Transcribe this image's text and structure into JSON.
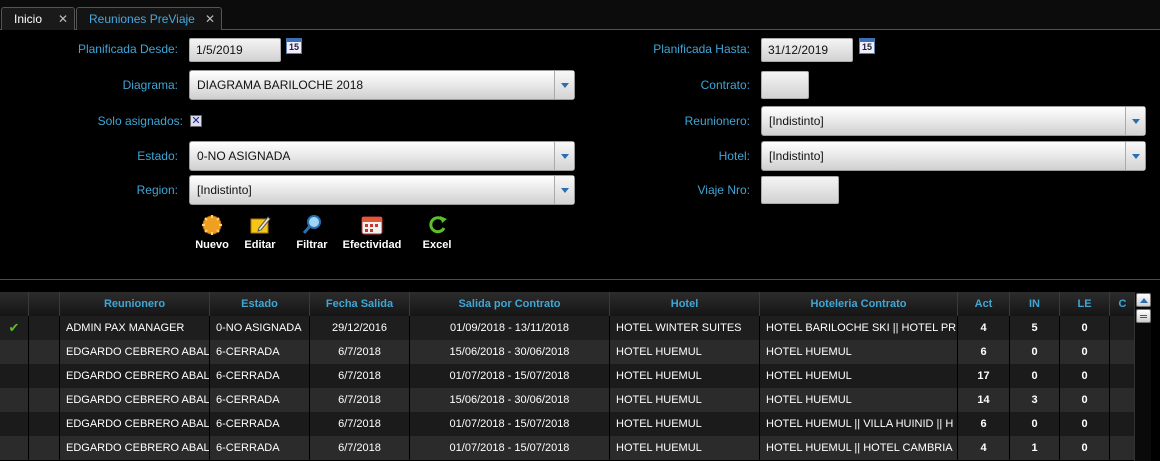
{
  "tabs": [
    {
      "label": "Inicio",
      "close": "✕"
    },
    {
      "label": "Reuniones PreViaje",
      "close": "✕"
    }
  ],
  "form": {
    "planificada_desde": {
      "label": "Planificada Desde:",
      "value": "1/5/2019"
    },
    "planificada_hasta": {
      "label": "Planificada Hasta:",
      "value": "31/12/2019"
    },
    "diagrama": {
      "label": "Diagrama:",
      "value": "DIAGRAMA BARILOCHE 2018"
    },
    "contrato": {
      "label": "Contrato:",
      "value": ""
    },
    "solo_asignados": {
      "label": "Solo asignados:",
      "checked": true,
      "mark": "✕"
    },
    "reunionero": {
      "label": "Reunionero:",
      "value": "[Indistinto]"
    },
    "estado": {
      "label": "Estado:",
      "value": "0-NO ASIGNADA"
    },
    "hotel": {
      "label": "Hotel:",
      "value": "[Indistinto]"
    },
    "region": {
      "label": "Region:",
      "value": "[Indistinto]"
    },
    "viaje_nro": {
      "label": "Viaje Nro:",
      "value": ""
    },
    "calendar_glyph": "15"
  },
  "toolbar": {
    "nuevo": "Nuevo",
    "editar": "Editar",
    "filtrar": "Filtrar",
    "efectividad": "Efectividad",
    "excel": "Excel"
  },
  "grid": {
    "columns": [
      "Reunionero",
      "Estado",
      "Fecha Salida",
      "Salida por Contrato",
      "Hotel",
      "Hoteleria Contrato",
      "Act",
      "IN",
      "LE",
      "C"
    ],
    "rows": [
      {
        "selected": true,
        "check": "✔",
        "reunionero": "ADMIN PAX MANAGER",
        "estado": "0-NO ASIGNADA",
        "fecha": "29/12/2016",
        "salida": "01/09/2018 - 13/11/2018",
        "hotel": "HOTEL WINTER SUITES",
        "hoteleria": "HOTEL BARILOCHE SKI || HOTEL PRES",
        "act": "4",
        "in": "5",
        "le": "0"
      },
      {
        "selected": false,
        "check": "",
        "reunionero": "EDGARDO CEBRERO ABALO",
        "estado": "6-CERRADA",
        "fecha": "6/7/2018",
        "salida": "15/06/2018 - 30/06/2018",
        "hotel": "HOTEL HUEMUL",
        "hoteleria": "HOTEL HUEMUL",
        "act": "6",
        "in": "0",
        "le": "0"
      },
      {
        "selected": false,
        "check": "",
        "reunionero": "EDGARDO CEBRERO ABALO",
        "estado": "6-CERRADA",
        "fecha": "6/7/2018",
        "salida": "01/07/2018 - 15/07/2018",
        "hotel": "HOTEL HUEMUL",
        "hoteleria": "HOTEL HUEMUL",
        "act": "17",
        "in": "0",
        "le": "0"
      },
      {
        "selected": false,
        "check": "",
        "reunionero": "EDGARDO CEBRERO ABALO",
        "estado": "6-CERRADA",
        "fecha": "6/7/2018",
        "salida": "15/06/2018 - 30/06/2018",
        "hotel": "HOTEL HUEMUL",
        "hoteleria": "HOTEL HUEMUL",
        "act": "14",
        "in": "3",
        "le": "0"
      },
      {
        "selected": false,
        "check": "",
        "reunionero": "EDGARDO CEBRERO ABALO",
        "estado": "6-CERRADA",
        "fecha": "6/7/2018",
        "salida": "01/07/2018 - 15/07/2018",
        "hotel": "HOTEL HUEMUL",
        "hoteleria": "HOTEL HUEMUL || VILLA HUINID || H",
        "act": "6",
        "in": "0",
        "le": "0"
      },
      {
        "selected": false,
        "check": "",
        "reunionero": "EDGARDO CEBRERO ABALO",
        "estado": "6-CERRADA",
        "fecha": "6/7/2018",
        "salida": "01/07/2018 - 15/07/2018",
        "hotel": "HOTEL HUEMUL",
        "hoteleria": "HOTEL HUEMUL || HOTEL CAMBRIA",
        "act": "4",
        "in": "1",
        "le": "0"
      }
    ]
  },
  "colors": {
    "accent": "#3fa6d6",
    "check": "#5cbf2a",
    "background": "#000000"
  }
}
